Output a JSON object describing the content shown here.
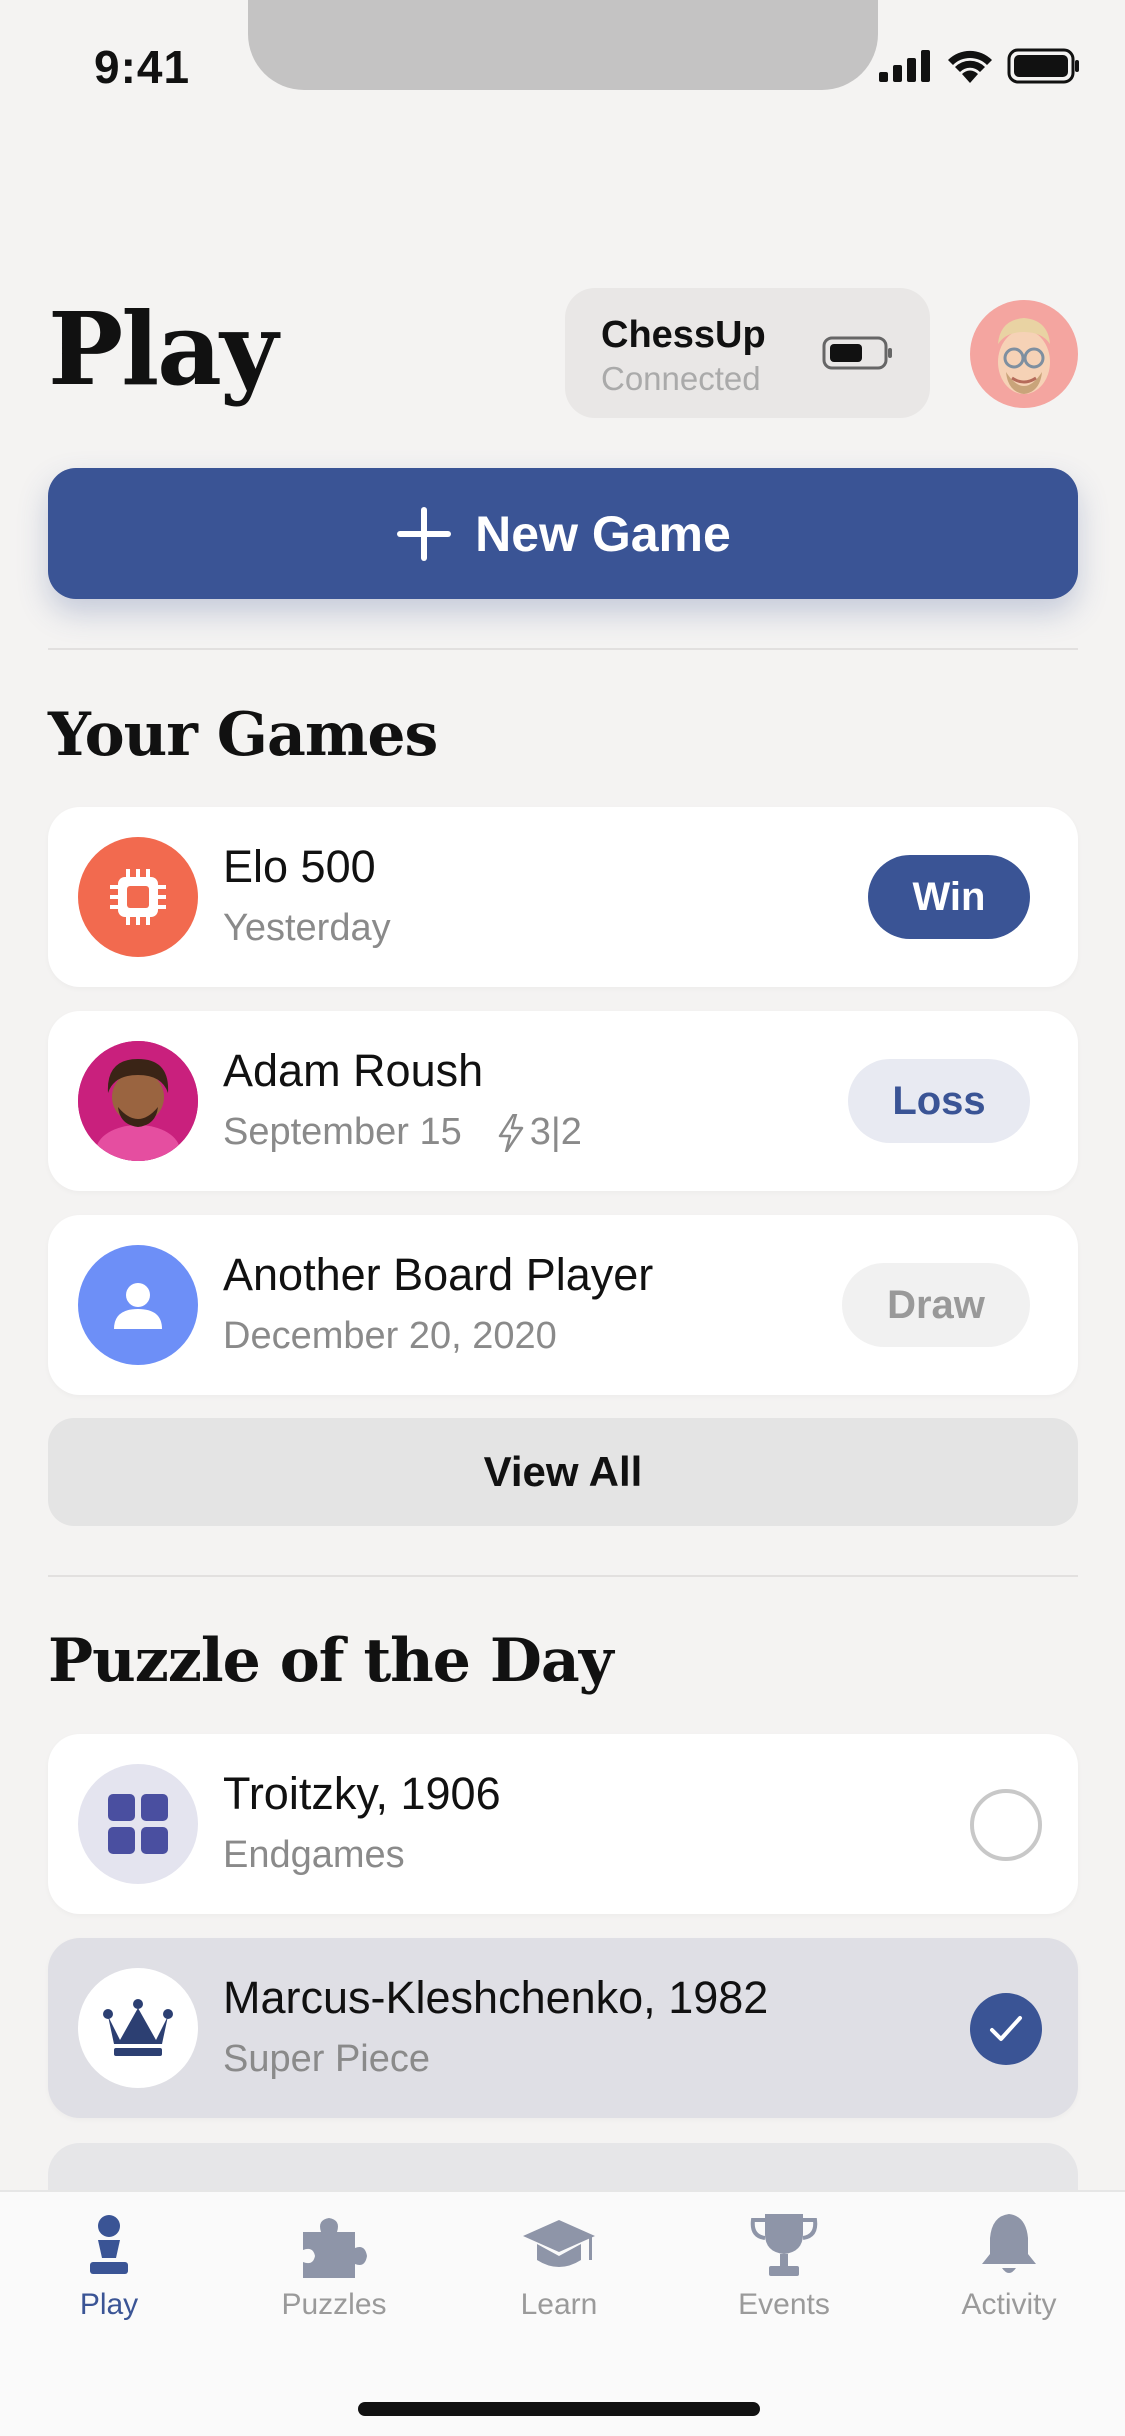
{
  "status_bar": {
    "time": "9:41"
  },
  "header": {
    "title": "Play",
    "device": {
      "name": "ChessUp",
      "status": "Connected"
    }
  },
  "new_game": {
    "label": "New Game"
  },
  "your_games": {
    "title": "Your Games",
    "games": [
      {
        "opponent": "Elo 500",
        "date": "Yesterday",
        "meta": "",
        "result": "Win"
      },
      {
        "opponent": "Adam Roush",
        "date": "September 15",
        "meta": "3|2",
        "result": "Loss"
      },
      {
        "opponent": "Another Board Player",
        "date": "December 20, 2020",
        "meta": "",
        "result": "Draw"
      }
    ],
    "view_all": "View All"
  },
  "puzzle_of_the_day": {
    "title": "Puzzle of the Day",
    "puzzles": [
      {
        "name": "Troitzky, 1906",
        "category": "Endgames",
        "completed": false
      },
      {
        "name": "Marcus-Kleshchenko, 1982",
        "category": "Super Piece",
        "completed": true
      }
    ]
  },
  "tab_bar": {
    "tabs": [
      {
        "label": "Play",
        "icon": "pawn-icon",
        "active": true
      },
      {
        "label": "Puzzles",
        "icon": "puzzle-icon",
        "active": false
      },
      {
        "label": "Learn",
        "icon": "graduation-cap-icon",
        "active": false
      },
      {
        "label": "Events",
        "icon": "trophy-icon",
        "active": false
      },
      {
        "label": "Activity",
        "icon": "bell-icon",
        "active": false
      }
    ]
  },
  "colors": {
    "accent": "#3a5495",
    "background": "#f4f3f2",
    "ai_avatar": "#f26a4f",
    "player_avatar": "#6d8ff7"
  }
}
